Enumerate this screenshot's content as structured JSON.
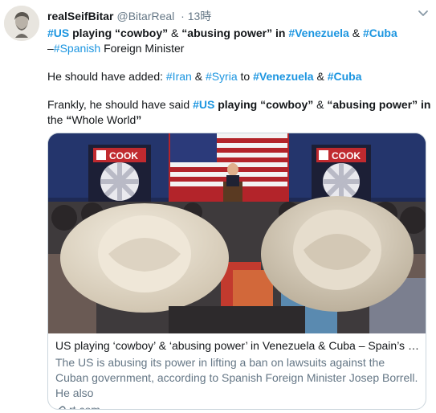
{
  "user": {
    "name": "realSeifBitar",
    "handle": "@BitarReal",
    "time": "13時"
  },
  "tweet": {
    "line1": [
      {
        "t": "#US",
        "c": "bht"
      },
      {
        "t": " playing ",
        "c": "b"
      },
      {
        "t": "“cowboy”",
        "c": "b"
      },
      {
        "t": " & ",
        "c": ""
      },
      {
        "t": "“abusing power”",
        "c": "b"
      },
      {
        "t": " in ",
        "c": "b"
      },
      {
        "t": "#Venezuela",
        "c": "bht"
      },
      {
        "t": " & ",
        "c": ""
      },
      {
        "t": "#Cuba",
        "c": "bht"
      }
    ],
    "line2": [
      {
        "t": "–",
        "c": ""
      },
      {
        "t": "#Spanish",
        "c": "ht"
      },
      {
        "t": " Foreign Minister",
        "c": ""
      }
    ],
    "line3": [
      {
        "t": "He should have added: ",
        "c": ""
      },
      {
        "t": "#Iran",
        "c": "ht"
      },
      {
        "t": " & ",
        "c": ""
      },
      {
        "t": "#Syria",
        "c": "ht"
      },
      {
        "t": " to ",
        "c": ""
      },
      {
        "t": "#Venezuela",
        "c": "bht"
      },
      {
        "t": " & ",
        "c": ""
      },
      {
        "t": "#Cuba",
        "c": "bht"
      }
    ],
    "line4": [
      {
        "t": "Frankly, he should have said ",
        "c": ""
      },
      {
        "t": "#US",
        "c": "bht"
      },
      {
        "t": " playing ",
        "c": "b"
      },
      {
        "t": "“cowboy”",
        "c": "b"
      },
      {
        "t": " & ",
        "c": ""
      },
      {
        "t": "“abusing power”",
        "c": "b"
      },
      {
        "t": " in",
        "c": "b"
      }
    ],
    "line5": [
      {
        "t": "the ",
        "c": ""
      },
      {
        "t": "“",
        "c": "b"
      },
      {
        "t": "Whole World",
        "c": ""
      },
      {
        "t": "”",
        "c": "b"
      }
    ]
  },
  "card": {
    "image_signs": [
      "COOK",
      "COOK"
    ],
    "title": "US playing ‘cowboy’ & ‘abusing power’ in Venezuela & Cuba – Spain’s FM...",
    "description": "The US is abusing its power in lifting a ban on lawsuits against the Cuban government, according to Spanish Foreign Minister Josep Borrell. He also",
    "domain": "rt.com"
  },
  "icons": {
    "caret": "chevron-down-icon",
    "link": "link-icon"
  },
  "colors": {
    "hashtag": "#1b95e0",
    "secondary_text": "#657786",
    "border": "#ccd6dd"
  }
}
